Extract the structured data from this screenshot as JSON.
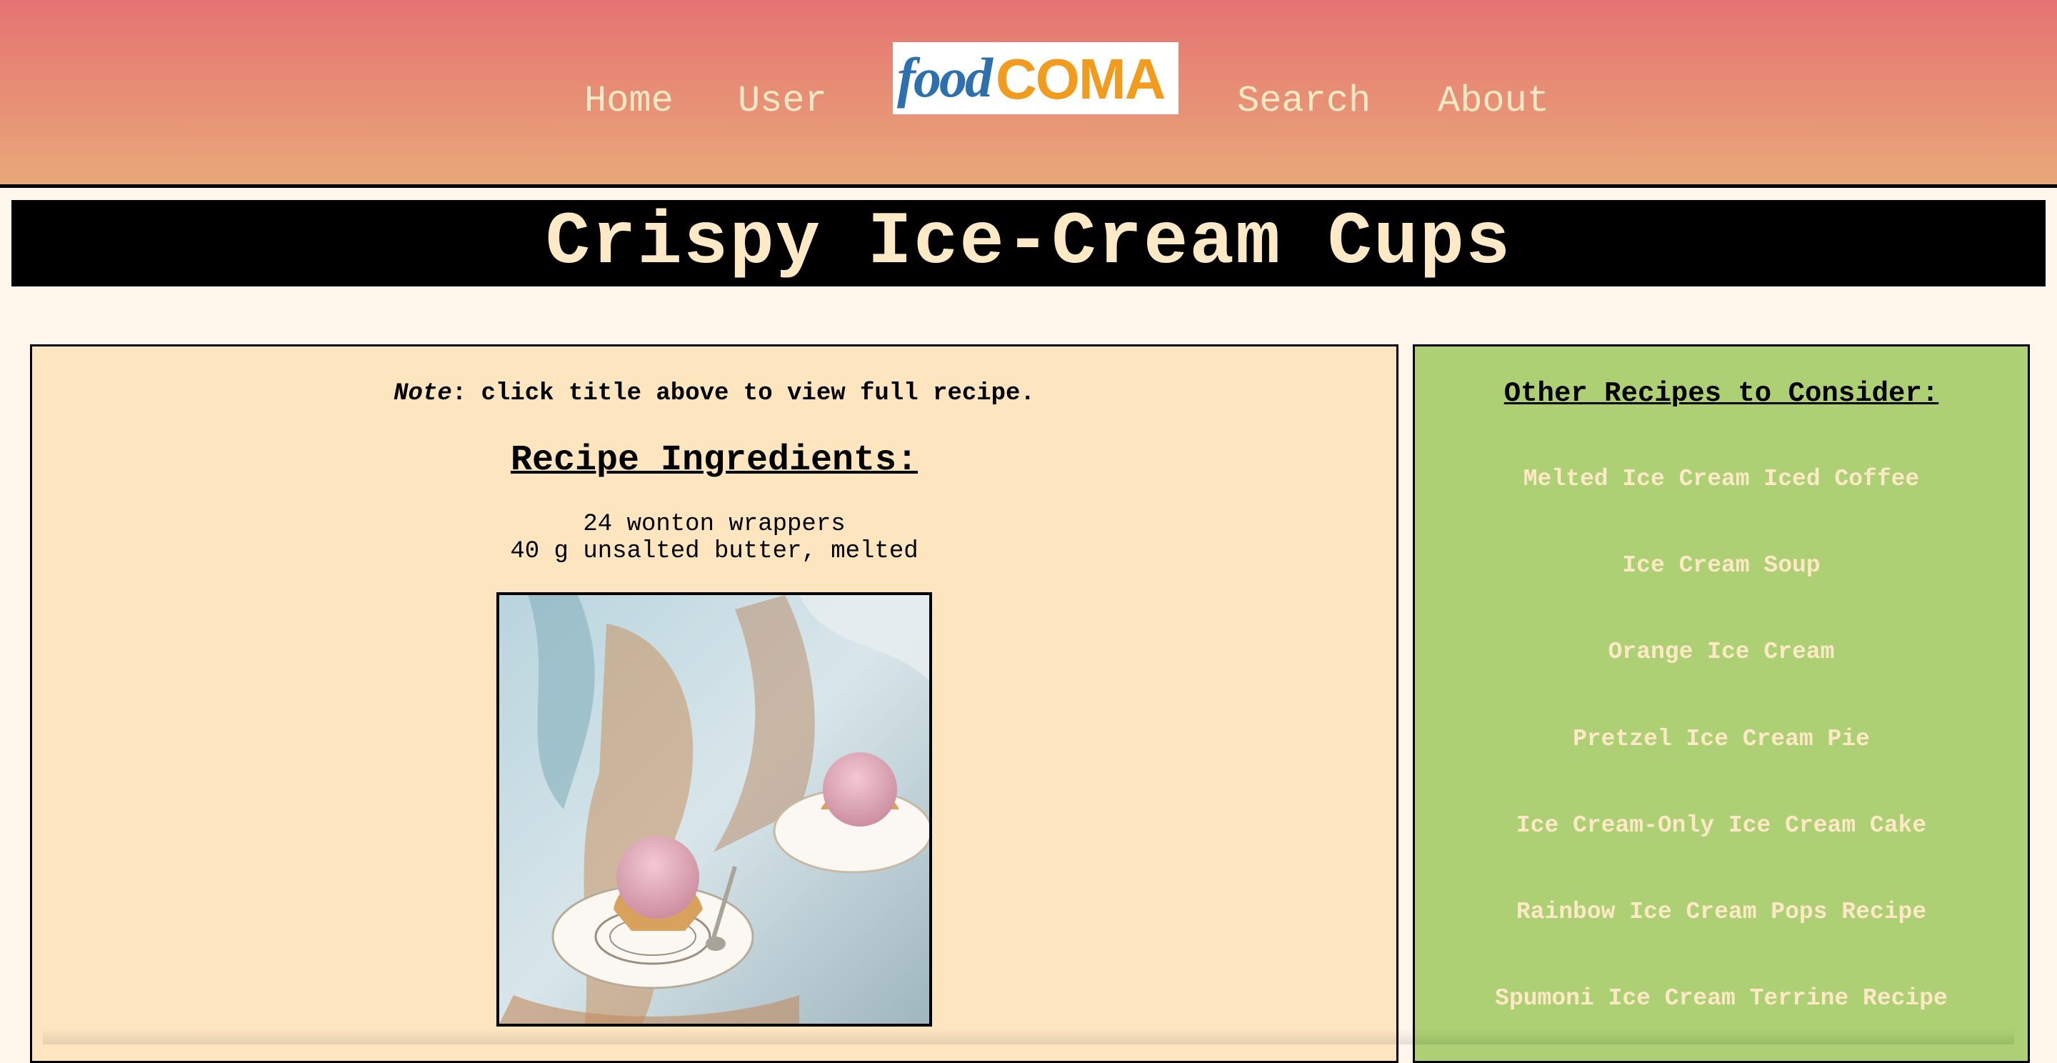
{
  "nav": {
    "home": "Home",
    "user": "User",
    "search": "Search",
    "about": "About",
    "logo_food": "food",
    "logo_coma": "COMA"
  },
  "recipe": {
    "title": "Crispy Ice-Cream Cups",
    "note_label": "Note",
    "note_text": ": click title above to view full recipe.",
    "ingredients_heading": "Recipe Ingredients:",
    "ingredients": [
      "24 wonton wrappers",
      "40 g unsalted butter, melted"
    ],
    "photo_icon": "ice-cream-photo"
  },
  "sidebar": {
    "heading": "Other Recipes to Consider:",
    "links": [
      "Melted Ice Cream Iced Coffee",
      "Ice Cream Soup",
      "Orange Ice Cream",
      "Pretzel Ice Cream Pie",
      "Ice Cream-Only Ice Cream Cake",
      "Rainbow Ice Cream Pops Recipe",
      "Spumoni Ice Cream Terrine Recipe"
    ]
  },
  "colors": {
    "header_top": "#e67373",
    "header_bottom": "#e8a878",
    "nav_text": "#fde9c6",
    "main_panel": "#fde5c0",
    "side_panel": "#add074",
    "logo_blue": "#2e6fad",
    "logo_orange": "#f29c1f"
  }
}
